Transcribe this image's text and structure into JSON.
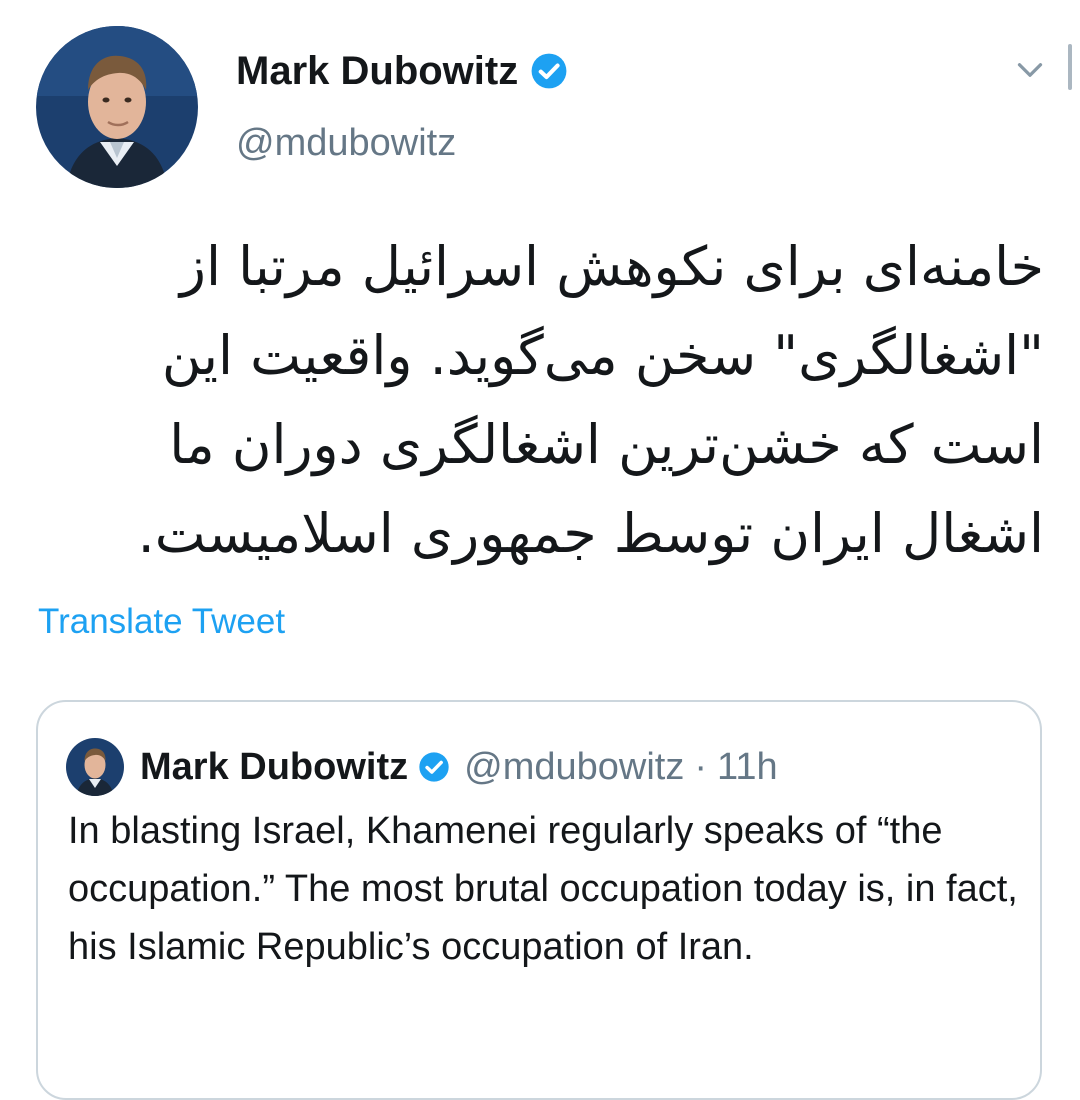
{
  "tweet": {
    "author": {
      "display_name": "Mark Dubowitz",
      "handle": "@mdubowitz",
      "verified": true
    },
    "text": "خامنه‌ای برای نکوهش اسرائیل مرتبا از \"اشغالگری\" سخن می‌گوید. واقعیت این است که خشن‌ترین اشغالگری دوران ما اشغال ایران توسط جمهوری اسلامیست.",
    "translate_label": "Translate Tweet",
    "menu_icon": "chevron-down-icon"
  },
  "quoted_tweet": {
    "author": {
      "display_name": "Mark Dubowitz",
      "handle": "@mdubowitz",
      "verified": true
    },
    "separator": "·",
    "time": "11h",
    "text": "In blasting Israel, Khamenei regularly speaks of “the occupation.” The most brutal occupation today is, in fact, his Islamic Republic’s occupation of Iran."
  },
  "colors": {
    "primary_text": "#14171a",
    "secondary_text": "#657786",
    "link": "#1da1f2",
    "verified_badge": "#1da1f2",
    "card_border": "#ccd6dd"
  }
}
